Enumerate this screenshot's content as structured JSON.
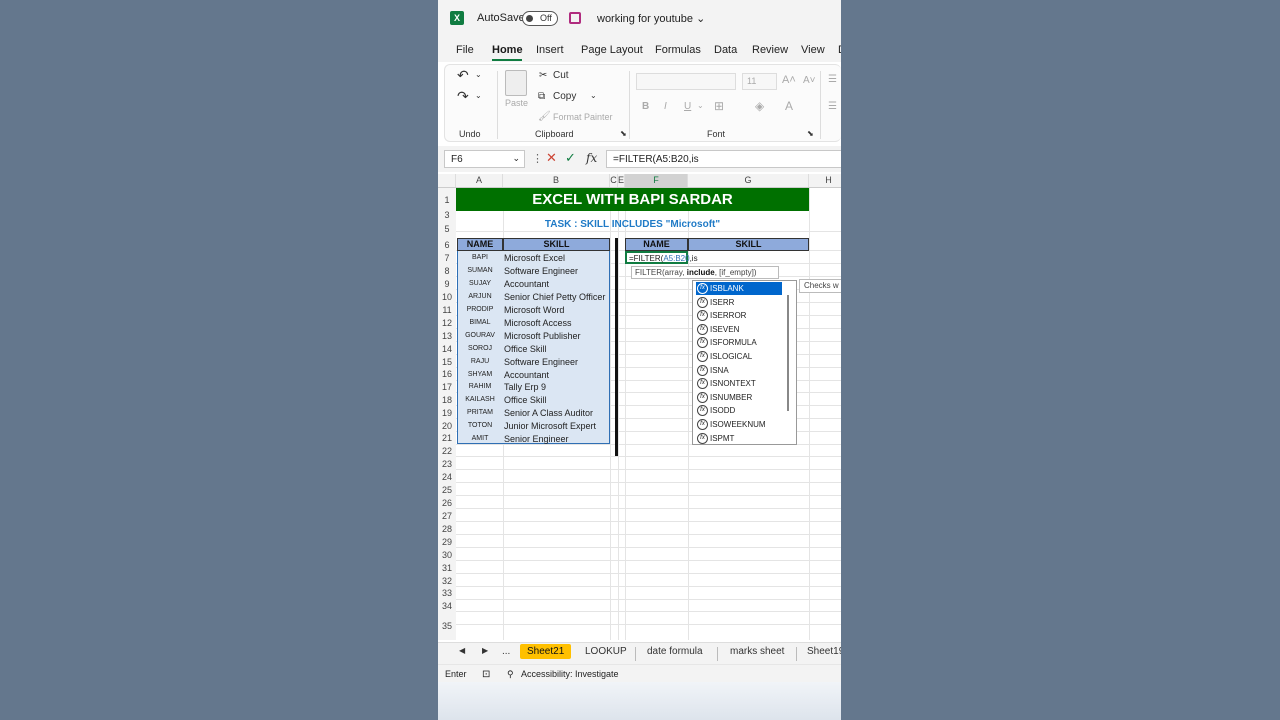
{
  "app": {
    "autosave_label": "AutoSave",
    "autosave_state": "Off",
    "doc_title": "working for youtube",
    "logo": "X"
  },
  "menu": [
    "File",
    "Home",
    "Insert",
    "Page Layout",
    "Formulas",
    "Data",
    "Review",
    "View",
    "D"
  ],
  "ribbon": {
    "undo_label": "Undo",
    "paste_label": "Paste",
    "cut_label": "Cut",
    "copy_label": "Copy",
    "format_painter_label": "Format Painter",
    "clipboard_label": "Clipboard",
    "font_label": "Font",
    "font_size": "11",
    "bold": "B",
    "italic": "I",
    "underline": "U"
  },
  "formula_bar": {
    "name_box": "F6",
    "formula": "=FILTER(A5:B20,is"
  },
  "columns": [
    "A",
    "B",
    "C",
    "E",
    "F",
    "G",
    "H"
  ],
  "rows": [
    "1",
    "3",
    "5",
    "6",
    "7",
    "8",
    "9",
    "10",
    "11",
    "12",
    "13",
    "14",
    "15",
    "16",
    "17",
    "18",
    "19",
    "20",
    "21",
    "22",
    "23",
    "24",
    "25",
    "26",
    "27",
    "28",
    "29",
    "30",
    "31",
    "32",
    "33",
    "34",
    "35"
  ],
  "sheet": {
    "banner": "EXCEL WITH BAPI SARDAR",
    "task": "TASK : SKILL INCLUDES \"Microsoft\"",
    "header_name": "NAME",
    "header_skill": "SKILL",
    "data": [
      [
        "BAPI",
        "Microsoft Excel"
      ],
      [
        "SUMAN",
        "Software Engineer"
      ],
      [
        "SUJAY",
        "Accountant"
      ],
      [
        "ARJUN",
        "Senior Chief Petty Officer"
      ],
      [
        "PRODIP",
        "Microsoft Word"
      ],
      [
        "BIMAL",
        "Microsoft Access"
      ],
      [
        "GOURAV",
        "Microsoft Publisher"
      ],
      [
        "SOROJ",
        "Office Skill"
      ],
      [
        "RAJU",
        "Software Engineer"
      ],
      [
        "SHYAM",
        "Accountant"
      ],
      [
        "RAHIM",
        "Tally Erp 9"
      ],
      [
        "KAILASH",
        "Office Skill"
      ],
      [
        "PRITAM",
        "Senior A Class Auditor"
      ],
      [
        "TOTON",
        "Junior Microsoft Expert"
      ],
      [
        "AMIT",
        "Senior Engineer"
      ]
    ],
    "result_header_name": "NAME",
    "result_header_skill": "SKILL",
    "cell_f6_prefix": "=FILTER(",
    "cell_f6_ref": "A5:B20",
    "cell_f6_suffix": ",is",
    "tooltip_pre": "FILTER(array, ",
    "tooltip_bold": "include",
    "tooltip_post": ", [if_empty])",
    "autocomplete": [
      "ISBLANK",
      "ISERR",
      "ISERROR",
      "ISEVEN",
      "ISFORMULA",
      "ISLOGICAL",
      "ISNA",
      "ISNONTEXT",
      "ISNUMBER",
      "ISODD",
      "ISOWEEKNUM",
      "ISPMT"
    ],
    "checks_text": "Checks w"
  },
  "tabs": {
    "more": "...",
    "items": [
      "Sheet21",
      "LOOKUP",
      "date formula",
      "marks sheet",
      "Sheet19"
    ]
  },
  "status": {
    "mode": "Enter",
    "accessibility": "Accessibility: Investigate"
  }
}
